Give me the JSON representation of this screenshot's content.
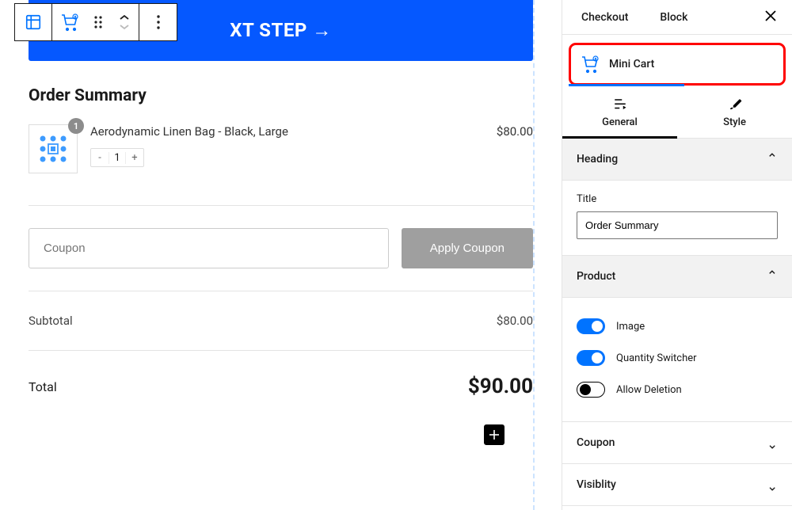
{
  "colors": {
    "accent": "#0073ff",
    "highlight": "#ff0000",
    "banner": "#0558ff"
  },
  "banner": {
    "text": "XT STEP →"
  },
  "toolbar": {
    "icons": [
      "grid-layout",
      "cart",
      "drag-handle",
      "up-down",
      "more"
    ]
  },
  "order_summary": {
    "heading": "Order Summary",
    "product": {
      "name": "Aerodynamic Linen Bag - Black, Large",
      "price": "$80.00",
      "qty": "1",
      "badge": "1",
      "thumb_icon_color": "#0073ff"
    },
    "coupon": {
      "placeholder": "Coupon",
      "apply_label": "Apply Coupon"
    },
    "subtotal_label": "Subtotal",
    "subtotal_value": "$80.00",
    "total_label": "Total",
    "total_value": "$90.00"
  },
  "sidebar": {
    "header": {
      "tab1": "Checkout",
      "tab2": "Block"
    },
    "crumb": {
      "label": "Mini Cart",
      "icon": "cart-icon"
    },
    "settings_tabs": {
      "general": "General",
      "style": "Style"
    },
    "sections": {
      "heading": {
        "title": "Heading",
        "field_label": "Title",
        "field_value": "Order Summary"
      },
      "product": {
        "title": "Product",
        "toggles": [
          {
            "label": "Image",
            "on": true
          },
          {
            "label": "Quantity Switcher",
            "on": true
          },
          {
            "label": "Allow Deletion",
            "on": false
          }
        ]
      },
      "coupon": {
        "title": "Coupon"
      },
      "visibility": {
        "title": "Visiblity"
      }
    }
  }
}
